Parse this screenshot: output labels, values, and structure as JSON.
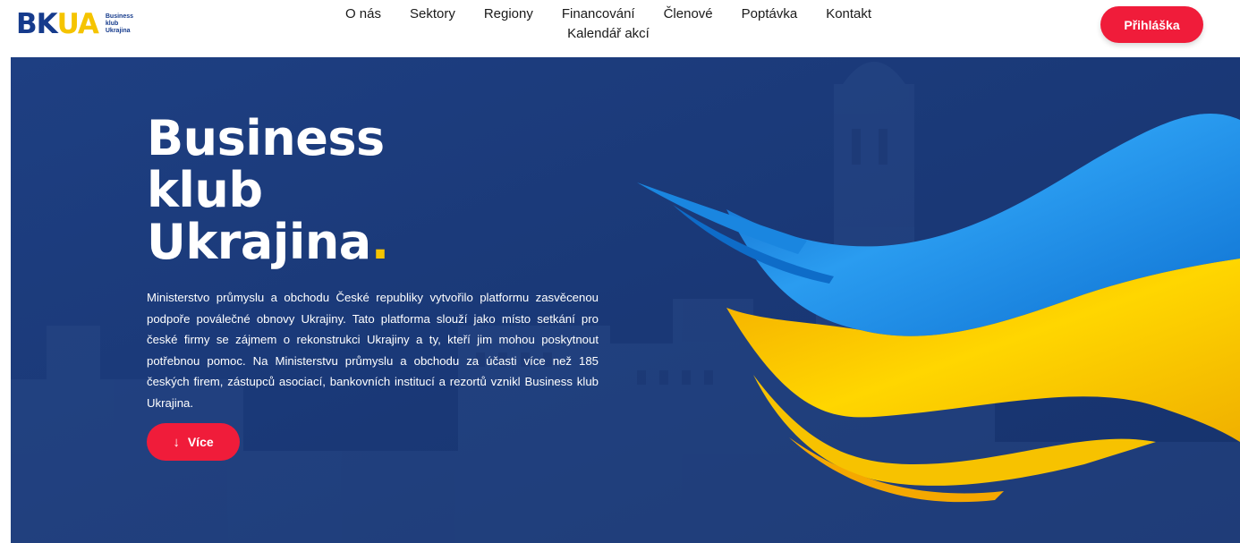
{
  "header": {
    "logo": {
      "mark_bk": "BK",
      "mark_ua": "UA",
      "sub_lines": [
        "Business",
        "klub",
        "Ukrajina"
      ]
    },
    "nav": [
      {
        "label": "O nás"
      },
      {
        "label": "Sektory"
      },
      {
        "label": "Regiony"
      },
      {
        "label": "Financování"
      },
      {
        "label": "Členové"
      },
      {
        "label": "Poptávka"
      },
      {
        "label": "Kontakt"
      },
      {
        "label": "Kalendář akcí"
      }
    ],
    "login_label": "Přihláška"
  },
  "hero": {
    "title_lines": [
      "Business",
      "klub",
      "Ukrajina"
    ],
    "title_dot": ".",
    "text": "Ministerstvo průmyslu a obchodu České republiky vytvořilo platformu zasvěcenou podpoře poválečné obnovy Ukrajiny. Tato platforma slouží jako místo setkání pro české firmy se zájmem o rekonstrukci Ukrajiny a ty, kteří jim mohou poskytnout potřebnou pomoc. Na Ministerstvu průmyslu a obchodu za účasti více než 185 českých firem, zástupců asociací, bankovních institucí a rezortů vznikl Business klub Ukrajina.",
    "more_icon": "↓",
    "more_label": "Více"
  },
  "colors": {
    "brand_blue": "#163b8c",
    "hero_bg": "#1b3a78",
    "flag_blue": "#1e8ee0",
    "flag_yellow": "#f5c400",
    "accent_red": "#f01c3a"
  }
}
